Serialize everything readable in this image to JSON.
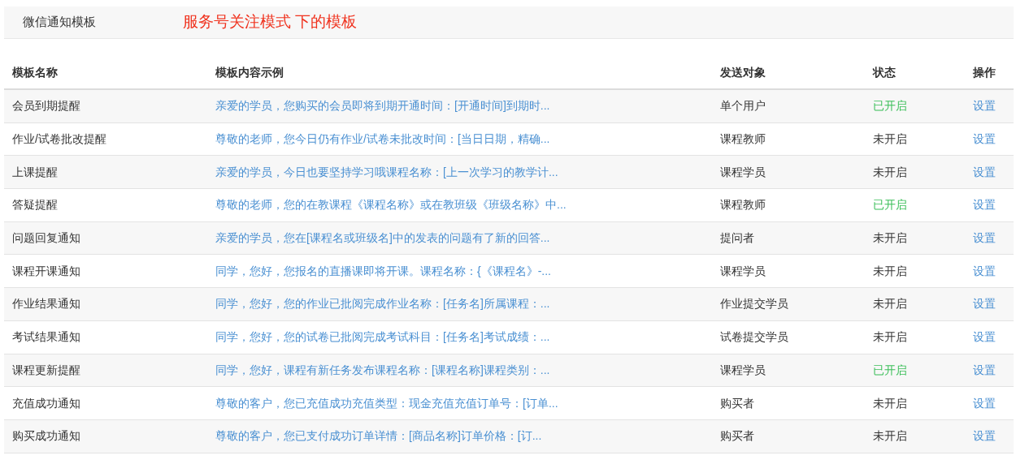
{
  "header": {
    "title": "微信通知模板",
    "subtitle": "服务号关注模式 下的模板"
  },
  "table": {
    "columns": [
      "模板名称",
      "模板内容示例",
      "发送对象",
      "状态",
      "操作"
    ],
    "rows": [
      {
        "name": "会员到期提醒",
        "content": "亲爱的学员，您购买的会员即将到期开通时间：[开通时间]到期时...",
        "target": "单个用户",
        "status": "已开启",
        "on": true,
        "action": "设置"
      },
      {
        "name": "作业/试卷批改提醒",
        "content": "尊敬的老师，您今日仍有作业/试卷未批改时间：[当日日期，精确...",
        "target": "课程教师",
        "status": "未开启",
        "on": false,
        "action": "设置"
      },
      {
        "name": "上课提醒",
        "content": "亲爱的学员，今日也要坚持学习哦课程名称：[上一次学习的教学计...",
        "target": "课程学员",
        "status": "未开启",
        "on": false,
        "action": "设置"
      },
      {
        "name": "答疑提醒",
        "content": "尊敬的老师，您的在教课程《课程名称》或在教班级《班级名称》中...",
        "target": "课程教师",
        "status": "已开启",
        "on": true,
        "action": "设置"
      },
      {
        "name": "问题回复通知",
        "content": "亲爱的学员，您在[课程名或班级名]中的发表的问题有了新的回答...",
        "target": "提问者",
        "status": "未开启",
        "on": false,
        "action": "设置"
      },
      {
        "name": "课程开课通知",
        "content": "同学，您好，您报名的直播课即将开课。课程名称：{《课程名》-...",
        "target": "课程学员",
        "status": "未开启",
        "on": false,
        "action": "设置"
      },
      {
        "name": "作业结果通知",
        "content": "同学，您好，您的作业已批阅完成作业名称：[任务名]所属课程：...",
        "target": "作业提交学员",
        "status": "未开启",
        "on": false,
        "action": "设置"
      },
      {
        "name": "考试结果通知",
        "content": "同学，您好，您的试卷已批阅完成考试科目：[任务名]考试成绩：...",
        "target": "试卷提交学员",
        "status": "未开启",
        "on": false,
        "action": "设置"
      },
      {
        "name": "课程更新提醒",
        "content": "同学，您好，课程有新任务发布课程名称：[课程名称]课程类别：...",
        "target": "课程学员",
        "status": "已开启",
        "on": true,
        "action": "设置"
      },
      {
        "name": "充值成功通知",
        "content": "尊敬的客户，您已充值成功充值类型：现金充值充值订单号：[订单...",
        "target": "购买者",
        "status": "未开启",
        "on": false,
        "action": "设置"
      },
      {
        "name": "购买成功通知",
        "content": "尊敬的客户，您已支付成功订单详情：[商品名称]订单价格：[订...",
        "target": "购买者",
        "status": "未开启",
        "on": false,
        "action": "设置"
      }
    ]
  }
}
